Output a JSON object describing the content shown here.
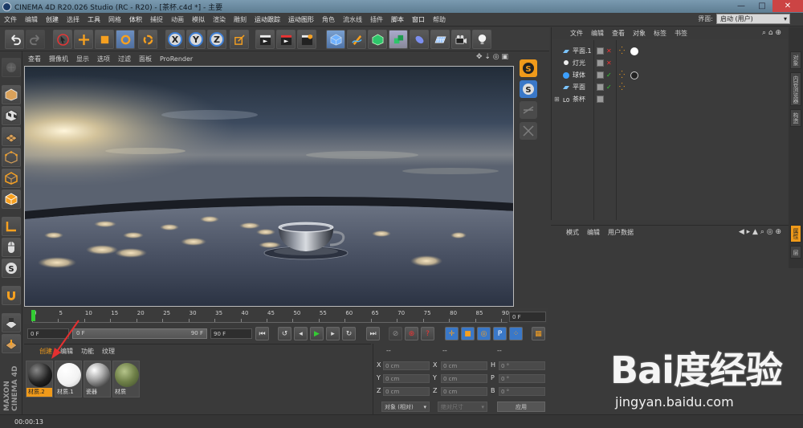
{
  "title_bar": {
    "title": "CINEMA 4D R20.026 Studio (RC - R20) - [茶杯.c4d *] - 主要"
  },
  "window_controls": {
    "minimize": "—",
    "maximize": "□",
    "close": "✕"
  },
  "menubar": {
    "items": [
      "文件",
      "编辑",
      "创建",
      "选择",
      "工具",
      "网格",
      "体积",
      "捕捉",
      "动画",
      "模拟",
      "渲染",
      "雕刻",
      "运动跟踪",
      "运动图形",
      "角色",
      "流水线",
      "插件",
      "脚本",
      "窗口",
      "帮助"
    ],
    "layout_label": "界面:",
    "layout_value": "启动 (用户)"
  },
  "viewport": {
    "menu": [
      "查看",
      "摄像机",
      "显示",
      "选项",
      "过滤",
      "面板",
      "ProRender"
    ]
  },
  "object_manager": {
    "menu": [
      "文件",
      "编辑",
      "查看",
      "对象",
      "标签",
      "书签"
    ],
    "objects": [
      {
        "name": "平面.1",
        "status": "red"
      },
      {
        "name": "灯光",
        "status": "red"
      },
      {
        "name": "球体",
        "status": "green"
      },
      {
        "name": "平面",
        "status": "green"
      },
      {
        "name": "茶杯",
        "status": "none"
      }
    ]
  },
  "side_tabs": [
    "对象",
    "内容浏览器",
    "构造"
  ],
  "attribute_manager": {
    "menu": [
      "模式",
      "编辑",
      "用户数据"
    ],
    "side_tabs": [
      "属性",
      "层"
    ]
  },
  "timeline": {
    "ticks": [
      "0",
      "5",
      "10",
      "15",
      "20",
      "25",
      "30",
      "35",
      "40",
      "45",
      "50",
      "55",
      "60",
      "65",
      "70",
      "75",
      "80",
      "85",
      "90"
    ],
    "current_frame_display": "0 F",
    "start_frame": "0 F",
    "range_start": "0 F",
    "range_end": "90 F",
    "end_frame": "90 F"
  },
  "material_manager": {
    "menu": [
      "创建",
      "编辑",
      "功能",
      "纹理"
    ],
    "materials": [
      {
        "name": "材质.2",
        "color": "dark",
        "selected": true
      },
      {
        "name": "材质.1",
        "color": "white",
        "selected": false
      },
      {
        "name": "瓷器",
        "color": "chrome",
        "selected": false
      },
      {
        "name": "材质",
        "color": "green",
        "selected": false
      }
    ]
  },
  "coordinates": {
    "headers": [
      "--",
      "--",
      "--"
    ],
    "rows": [
      {
        "a": "X",
        "av": "0 cm",
        "b": "X",
        "bv": "0 cm",
        "c": "H",
        "cv": "0 °"
      },
      {
        "a": "Y",
        "av": "0 cm",
        "b": "Y",
        "bv": "0 cm",
        "c": "P",
        "cv": "0 °"
      },
      {
        "a": "Z",
        "av": "0 cm",
        "b": "Z",
        "bv": "0 cm",
        "c": "B",
        "cv": "0 °"
      }
    ],
    "mode_select": "对象 (相对)",
    "size_select": "绝对尺寸",
    "apply": "应用"
  },
  "status": {
    "time": "00:00:13"
  },
  "branding": {
    "maxon": "MAXON CINEMA 4D"
  },
  "watermark": {
    "brand": "Bai度经验",
    "url": "jingyan.baidu.com"
  },
  "colors": {
    "accent_orange": "#f09a1a",
    "selection_blue": "#3a78c8",
    "red_arrow": "#e53030"
  }
}
